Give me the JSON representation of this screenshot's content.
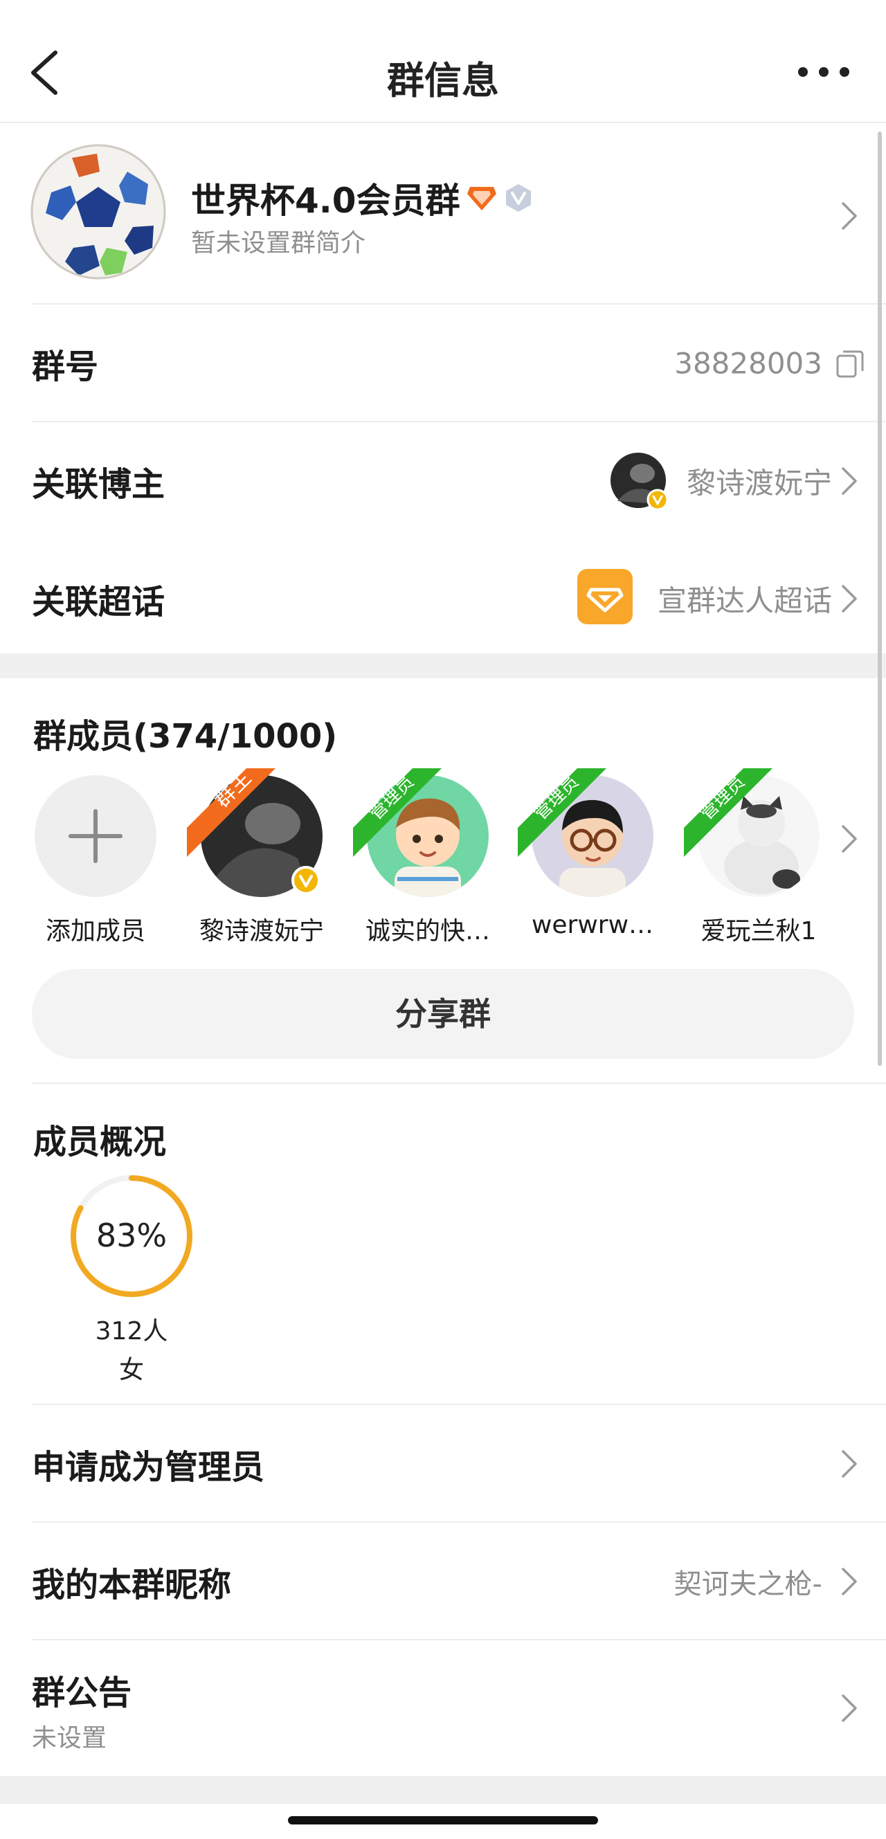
{
  "nav": {
    "title": "群信息",
    "back_icon": "chevron-left-icon",
    "more_icon": "ellipsis-icon"
  },
  "group": {
    "name": "世界杯4.0会员群",
    "description": "暂未设置群简介",
    "badge_colors": {
      "diamond": "#f26b1d",
      "vip": "#b9c3d6"
    }
  },
  "group_id": {
    "label": "群号",
    "value": "38828003",
    "copy_icon": "copy-icon"
  },
  "linked_blogger": {
    "label": "关联博主",
    "value": "黎诗渡妧宁"
  },
  "linked_topic": {
    "label": "关联超话",
    "value": "宣群达人超话",
    "icon_color": "#f8a72a"
  },
  "members_section": {
    "title": "群成员(374/1000)",
    "add_label": "添加成员",
    "members": [
      {
        "name": "黎诗渡妧宁",
        "role": "群主",
        "role_color": "#f26b1d"
      },
      {
        "name": "诚实的快…",
        "role": "管理员",
        "role_color": "#2cb52c"
      },
      {
        "name": "werwrw…",
        "role": "管理员",
        "role_color": "#2cb52c"
      },
      {
        "name": "爱玩兰秋1",
        "role": "管理员",
        "role_color": "#2cb52c"
      }
    ],
    "share_label": "分享群"
  },
  "overview": {
    "title": "成员概况",
    "percent_text": "83%",
    "percent_value": 0.83,
    "count": "312人",
    "gender": "女",
    "ring_color": "#f2a922"
  },
  "apply_admin": {
    "label": "申请成为管理员"
  },
  "nickname": {
    "label": "我的本群昵称",
    "value": "契诃夫之枪-"
  },
  "announcement": {
    "label": "群公告",
    "value": "未设置"
  },
  "accent": {
    "gold": "#f2b705",
    "gray_text": "#8f8f8f"
  }
}
